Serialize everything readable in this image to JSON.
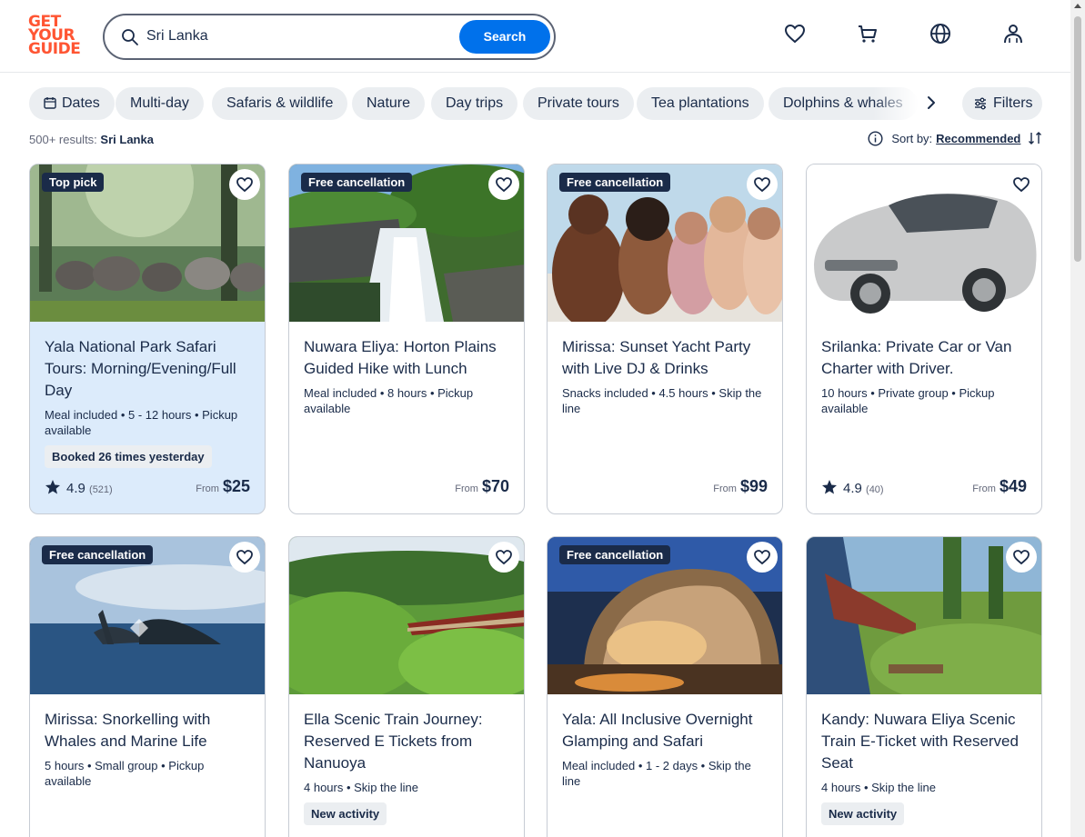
{
  "logo": {
    "line1": "GET",
    "line2": "YOUR",
    "line3": "GUIDE"
  },
  "search": {
    "value": "Sri Lanka",
    "button": "Search"
  },
  "filters_bar": {
    "chips": [
      "Dates",
      "Multi-day",
      "Safaris & wildlife",
      "Nature",
      "Day trips",
      "Private tours",
      "Tea plantations",
      "Dolphins & whales"
    ],
    "filters_label": "Filters"
  },
  "results": {
    "count": "500+ results:",
    "query": "Sri Lanka"
  },
  "sort": {
    "label": "Sort by:",
    "value": "Recommended"
  },
  "cards": [
    {
      "badge": "Top pick",
      "title": "Yala National Park Safari Tours: Morning/Evening/Full Day",
      "meta": "Meal included • 5 - 12 hours • Pickup available",
      "pill": "Booked 26 times yesterday",
      "rating": "4.9",
      "reviews": "(521)",
      "from": "From",
      "price": "$25"
    },
    {
      "badge": "Free cancellation",
      "title": "Nuwara Eliya: Horton Plains Guided Hike with Lunch",
      "meta": "Meal included • 8 hours • Pickup available",
      "pill": "",
      "rating": "",
      "reviews": "",
      "from": "From",
      "price": "$70"
    },
    {
      "badge": "Free cancellation",
      "title": "Mirissa: Sunset Yacht Party with Live DJ & Drinks",
      "meta": "Snacks included • 4.5 hours • Skip the line",
      "pill": "",
      "rating": "",
      "reviews": "",
      "from": "From",
      "price": "$99"
    },
    {
      "badge": "",
      "title": "Srilanka: Private Car or Van Charter with Driver.",
      "meta": "10 hours • Private group • Pickup available",
      "pill": "",
      "rating": "4.9",
      "reviews": "(40)",
      "from": "From",
      "price": "$49"
    },
    {
      "badge": "Free cancellation",
      "title": "Mirissa: Snorkelling with Whales and Marine Life",
      "meta": "5 hours • Small group • Pickup available",
      "pill": ""
    },
    {
      "badge": "",
      "title": "Ella Scenic Train Journey: Reserved E Tickets from Nanuoya",
      "meta": "4 hours • Skip the line",
      "pill": "New activity"
    },
    {
      "badge": "Free cancellation",
      "title": "Yala: All Inclusive Overnight Glamping and Safari",
      "meta": "Meal included • 1 - 2 days • Skip the line",
      "pill": ""
    },
    {
      "badge": "",
      "title": "Kandy: Nuwara Eliya Scenic Train E-Ticket with Reserved Seat",
      "meta": "4 hours • Skip the line",
      "pill": "New activity"
    }
  ],
  "colors": {
    "brand": "#ff5533",
    "accent": "#0071eb",
    "navy": "#1a2b49",
    "highlight": "#dcebfb"
  },
  "icons": [
    "search-icon",
    "heart-icon",
    "cart-icon",
    "globe-icon",
    "profile-icon",
    "calendar-icon",
    "chevron-right-icon",
    "filters-icon",
    "info-icon",
    "sort-icon",
    "star-icon"
  ]
}
